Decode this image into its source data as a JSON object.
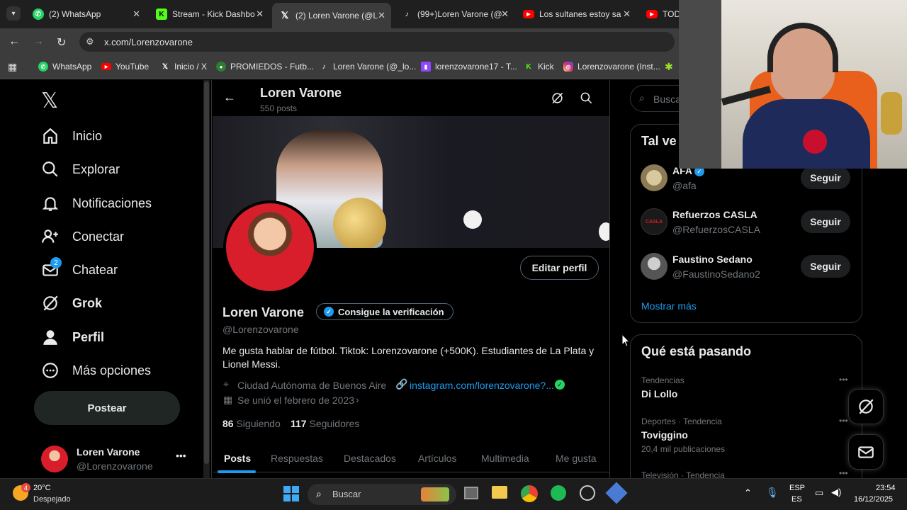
{
  "browser": {
    "tabs": [
      {
        "label": "(2) WhatsApp",
        "icon": "whatsapp-icon",
        "color": "#25d366"
      },
      {
        "label": "Stream - Kick Dashbo",
        "icon": "kick-icon",
        "color": "#53fc18"
      },
      {
        "label": "(2) Loren Varone (@L",
        "icon": "x-icon",
        "color": "#ffffff"
      },
      {
        "label": "(99+)Loren Varone (@",
        "icon": "tiktok-icon",
        "color": "#ffffff"
      },
      {
        "label": "Los sultanes estoy sa",
        "icon": "youtube-icon",
        "color": "#ff0000"
      },
      {
        "label": "TODO",
        "icon": "youtube-icon",
        "color": "#ff0000"
      }
    ],
    "url": "x.com/Lorenzovarone",
    "bookmarks": [
      {
        "label": "WhatsApp",
        "icon": "whatsapp-icon"
      },
      {
        "label": "YouTube",
        "icon": "youtube-icon"
      },
      {
        "label": "Inicio / X",
        "icon": "x-icon"
      },
      {
        "label": "PROMIEDOS - Futb...",
        "icon": "promiedos-icon"
      },
      {
        "label": "Loren Varone (@_lo...",
        "icon": "tiktok-icon"
      },
      {
        "label": "lorenzovarone17 - T...",
        "icon": "twitch-icon"
      },
      {
        "label": "Kick",
        "icon": "kick-icon"
      },
      {
        "label": "Lorenzovarone (Inst...",
        "icon": "instagram-icon"
      }
    ]
  },
  "sidebar": {
    "items": [
      {
        "label": "Inicio",
        "icon": "home-icon"
      },
      {
        "label": "Explorar",
        "icon": "search-icon"
      },
      {
        "label": "Notificaciones",
        "icon": "bell-icon"
      },
      {
        "label": "Conectar",
        "icon": "add-person-icon"
      },
      {
        "label": "Chatear",
        "icon": "mail-icon",
        "badge": "2"
      },
      {
        "label": "Grok",
        "icon": "grok-icon"
      },
      {
        "label": "Perfil",
        "icon": "person-icon"
      },
      {
        "label": "Más opciones",
        "icon": "more-circle-icon"
      }
    ],
    "post_label": "Postear",
    "account": {
      "name": "Loren Varone",
      "handle": "@Lorenzovarone"
    }
  },
  "profile": {
    "header_name": "Loren Varone",
    "posts_count": "550 posts",
    "name": "Loren Varone",
    "handle": "@Lorenzovarone",
    "verify_label": "Consigue la verificación",
    "edit_label": "Editar perfil",
    "bio_line1": "Me gusta hablar de fútbol. Tiktok: Lorenzovarone (+500K). Estudiantes de La Plata y",
    "bio_line2": "Lionel Messi.",
    "location": "Ciudad Autónoma de Buenos Aire",
    "link": "instagram.com/lorenzovarone?...",
    "joined": "Se unió el febrero de 2023",
    "following_count": "86",
    "following_label": "Siguiendo",
    "followers_count": "117",
    "followers_label": "Seguidores",
    "tabs": [
      "Posts",
      "Respuestas",
      "Destacados",
      "Artículos",
      "Multimedia",
      "Me gusta"
    ]
  },
  "right": {
    "search_placeholder": "Buscar",
    "suggest_title": "Tal ve",
    "suggestions": [
      {
        "name": "AFA",
        "handle": "@afa",
        "button": "Seguir",
        "verified": true
      },
      {
        "name": "Refuerzos CASLA",
        "handle": "@RefuerzosCASLA",
        "button": "Seguir",
        "verified": false
      },
      {
        "name": "Faustino Sedano",
        "handle": "@FaustinoSedano2",
        "button": "Seguir",
        "verified": false
      }
    ],
    "show_more": "Mostrar más",
    "trending_title": "Qué está pasando",
    "trends": [
      {
        "context": "Tendencias",
        "topic": "Di Lollo",
        "posts": ""
      },
      {
        "context": "Deportes · Tendencia",
        "topic": "Toviggino",
        "posts": "20,4 mil publicaciones"
      },
      {
        "context": "Televisión · Tendencia",
        "topic": "",
        "posts": ""
      }
    ]
  },
  "taskbar": {
    "weather_temp": "20°C",
    "weather_desc": "Despejado",
    "weather_badge": "4",
    "search_label": "Buscar",
    "lang1": "ESP",
    "lang2": "ES",
    "time": "23:54",
    "date": "16/12/2025"
  },
  "colors": {
    "accent": "#1d9bf0",
    "background": "#000000",
    "border": "#2f3336"
  }
}
